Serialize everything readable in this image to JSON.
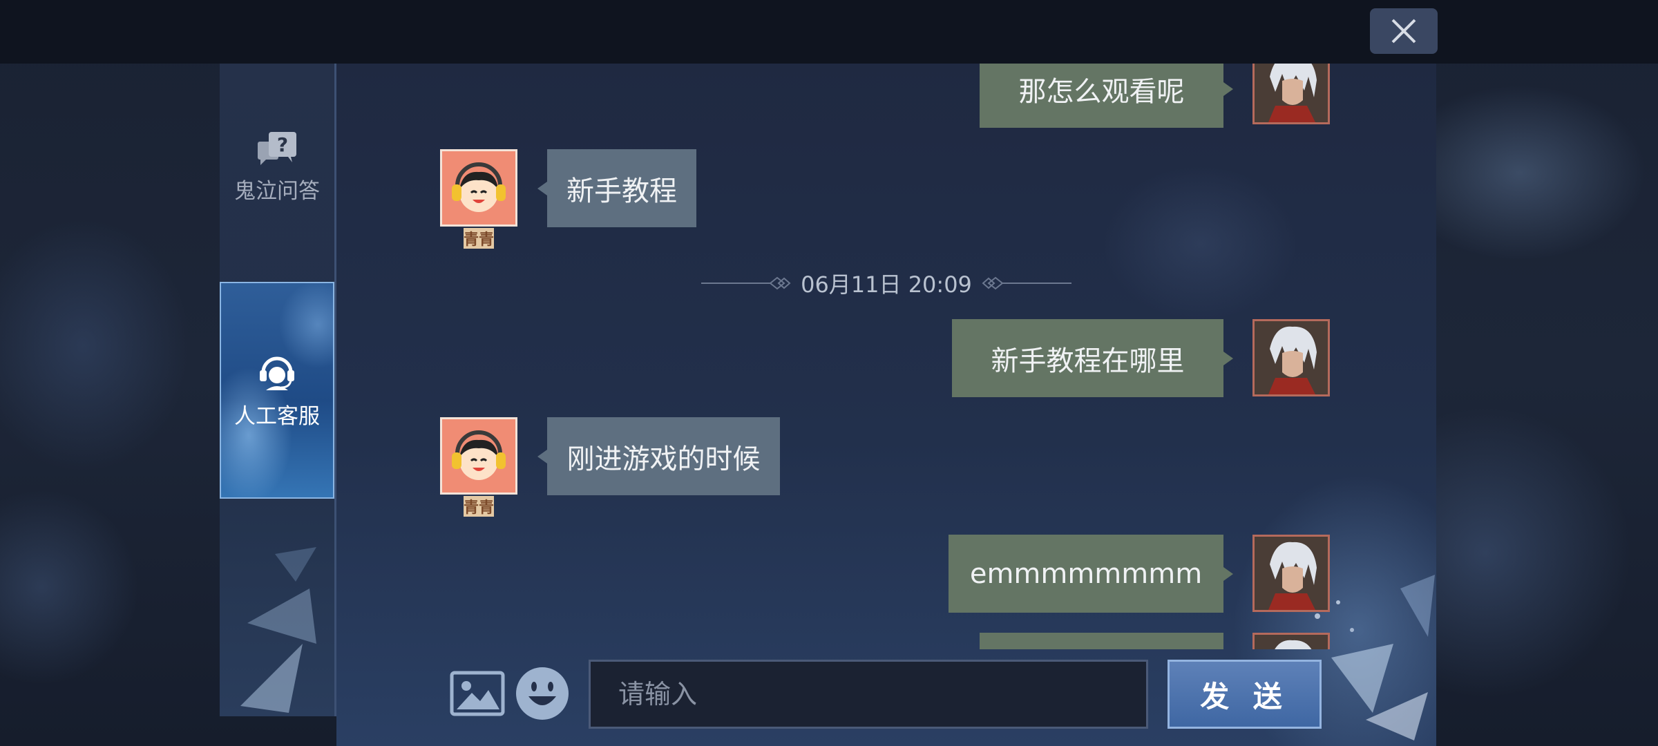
{
  "header": {
    "close_icon": "close-icon"
  },
  "sidebar": {
    "items": [
      {
        "label": "鬼泣问答",
        "icon": "question-bubble-icon",
        "active": false
      },
      {
        "label": "人工客服",
        "icon": "headset-support-icon",
        "active": true
      }
    ]
  },
  "chat": {
    "messages": [
      {
        "from": "user",
        "text": "那怎么观看呢"
      },
      {
        "from": "agent",
        "text": "新手教程",
        "agent_name": "青青"
      },
      {
        "from": "user",
        "text": "新手教程在哪里"
      },
      {
        "from": "agent",
        "text": "刚进游戏的时候",
        "agent_name": "青青"
      },
      {
        "from": "user",
        "text": "emmmmmmmm"
      }
    ],
    "timestamp": "06月11日 20:09"
  },
  "composer": {
    "placeholder": "请输入",
    "send_label": "发 送",
    "image_icon": "image-icon",
    "emoji_icon": "emoji-icon"
  },
  "colors": {
    "user_bubble": "#647564",
    "agent_bubble": "#5e6f80",
    "send_button": "#4a70ac",
    "active_tab": "#2f5e99"
  }
}
